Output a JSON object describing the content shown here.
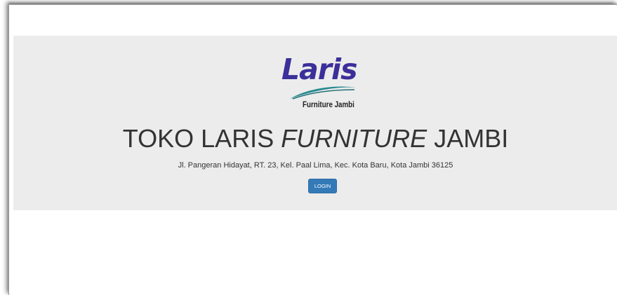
{
  "logo": {
    "word": "Laris",
    "subtitle": "Furniture Jambi",
    "brand_color": "#3b2f9a",
    "swoosh_color": "#2a8a8f"
  },
  "hero": {
    "title_part1": "TOKO LARIS ",
    "title_italic": "FURNITURE",
    "title_part2": " JAMBI",
    "address": "Jl. Pangeran Hidayat, RT. 23, Kel. Paal Lima, Kec. Kota Baru, Kota Jambi 36125",
    "login_label": "LOGIN",
    "login_color": "#337ab7",
    "background": "#ececec"
  }
}
